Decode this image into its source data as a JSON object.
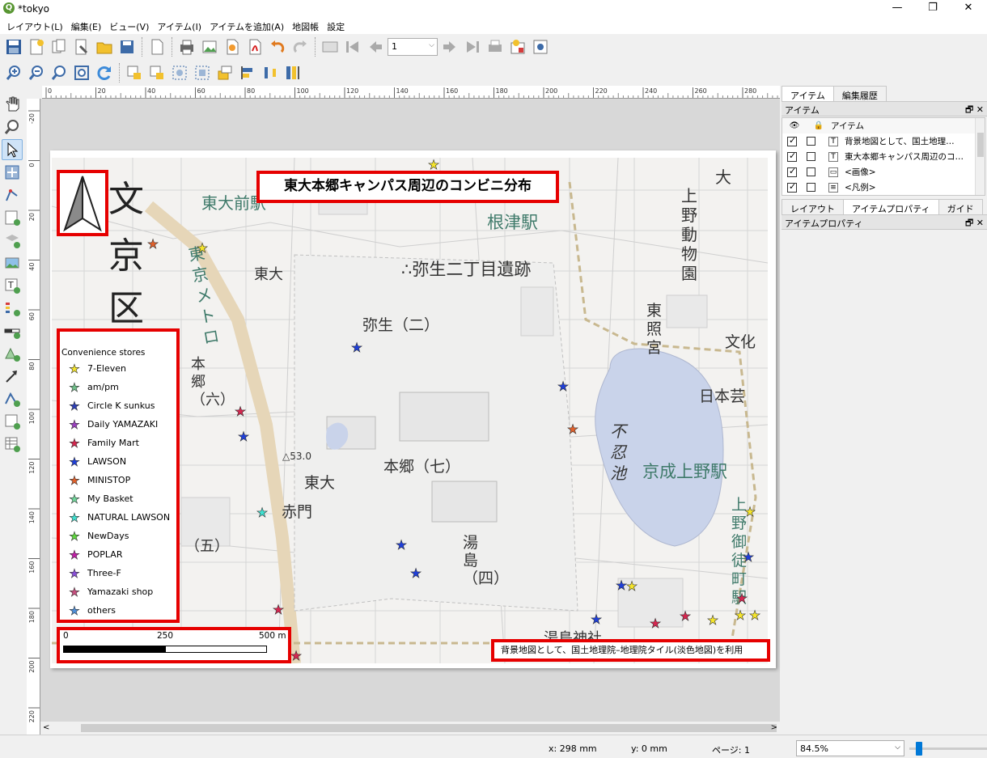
{
  "window": {
    "title": "*tokyo",
    "minimize": "—",
    "restore": "❐",
    "close": "✕"
  },
  "menu": [
    "レイアウト(L)",
    "編集(E)",
    "ビュー(V)",
    "アイテム(I)",
    "アイテムを追加(A)",
    "地図帳",
    "設定"
  ],
  "toolbar": {
    "page_value": "1",
    "dropdown_glyph": "⌵"
  },
  "ruler": {
    "h_ticks": [
      "0",
      "20",
      "40",
      "60",
      "80",
      "100",
      "120",
      "140",
      "160",
      "180",
      "200",
      "220",
      "240",
      "260",
      "280"
    ],
    "v_ticks": [
      "-20",
      "0",
      "20",
      "40",
      "60",
      "80",
      "100",
      "120",
      "140",
      "160",
      "180",
      "200",
      "220"
    ]
  },
  "map": {
    "title": "東大本郷キャンパス周辺のコンビニ分布",
    "attribution": "背景地図として、国土地理院–地理院タイル(淡色地図)を利用",
    "scale": {
      "label_start": "0",
      "label_mid": "250",
      "label_end": "500 m"
    },
    "labels": {
      "bunkyo1": "文",
      "bunkyo2": "京",
      "bunkyo3": "区",
      "todaimae": "東大前駅",
      "todai1": "東大",
      "yayoi_site": "∴弥生二丁目遺跡",
      "nezu": "根津駅",
      "ueno_zoo": "上野動物園",
      "yayoi2": "弥生（二）",
      "toshogu": "東照宮",
      "bunka": "文化",
      "nihon": "日本芸",
      "shinobazu": "不忍池",
      "keisei": "京成上野駅",
      "hongo7": "本郷（七）",
      "todai2": "東大",
      "akamon": "赤門",
      "go": "（五）",
      "yushima": "湯島（四）",
      "yushimajinja": "湯島神社",
      "hongo6": "本郷（六）",
      "metro": "東京メトロ",
      "uenookachi": "上野御徒町駅",
      "elev": "△53.0",
      "dai": "大"
    },
    "legend": {
      "title": "Convenience stores",
      "items": [
        {
          "label": "7-Eleven",
          "color": "#f5e52a"
        },
        {
          "label": "am/pm",
          "color": "#6fc089"
        },
        {
          "label": "Circle K sunkus",
          "color": "#2d3fb7"
        },
        {
          "label": "Daily YAMAZAKI",
          "color": "#9b3fbf"
        },
        {
          "label": "Family Mart",
          "color": "#d6264f"
        },
        {
          "label": "LAWSON",
          "color": "#1f3fd9"
        },
        {
          "label": "MINISTOP",
          "color": "#e0602b"
        },
        {
          "label": "My Basket",
          "color": "#6fd89b"
        },
        {
          "label": "NATURAL LAWSON",
          "color": "#3fe0d0"
        },
        {
          "label": "NewDays",
          "color": "#5fd83f"
        },
        {
          "label": "POPLAR",
          "color": "#c21fa8"
        },
        {
          "label": "Three-F",
          "color": "#8a4fd9"
        },
        {
          "label": "Yamazaki shop",
          "color": "#c84f7f"
        },
        {
          "label": "others",
          "color": "#4f8fd9"
        }
      ]
    }
  },
  "right_panel": {
    "tabs_top": [
      "アイテム",
      "編集履歴"
    ],
    "items_header": "アイテム",
    "items_col": "アイテム",
    "items": [
      {
        "label": "背景地図として、国土地理…",
        "icon": "T"
      },
      {
        "label": "東大本郷キャンパス周辺のコ…",
        "icon": "T"
      },
      {
        "label": "<画像>",
        "icon": "▭"
      },
      {
        "label": "<凡例>",
        "icon": "≡"
      }
    ],
    "tabs_bottom": [
      "レイアウト",
      "アイテムプロパティ",
      "ガイド"
    ],
    "props_header": "アイテムプロパティ",
    "panel_ctl": "🗗 ✕"
  },
  "status": {
    "x": "x: 298 mm",
    "y": "y: 0 mm",
    "page": "ページ: 1",
    "zoom": "84.5%"
  }
}
